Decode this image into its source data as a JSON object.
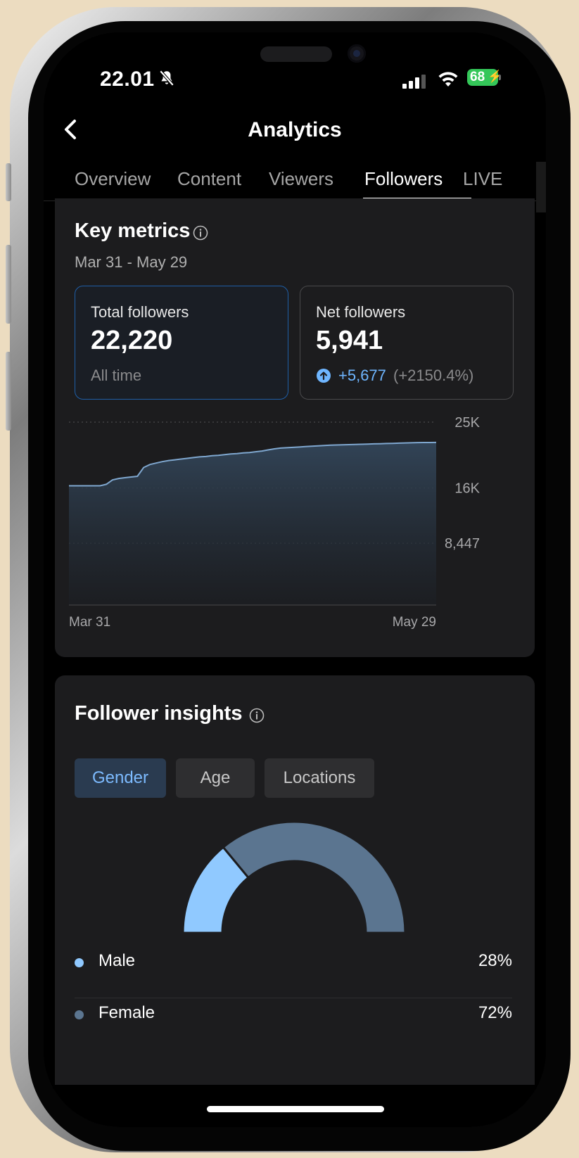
{
  "status_bar": {
    "time": "22.01",
    "battery": "68"
  },
  "nav": {
    "title": "Analytics"
  },
  "tabs": [
    {
      "label": "Overview"
    },
    {
      "label": "Content"
    },
    {
      "label": "Viewers"
    },
    {
      "label": "Followers"
    },
    {
      "label": "LIVE"
    }
  ],
  "active_tab": "Followers",
  "key_metrics": {
    "title": "Key metrics",
    "date_range": "Mar 31 - May 29",
    "total": {
      "label": "Total followers",
      "value": "22,220",
      "sub": "All time"
    },
    "net": {
      "label": "Net followers",
      "value": "5,941",
      "delta": "+5,677",
      "delta_pct": "(+2150.4%)"
    }
  },
  "chart_data": {
    "type": "area",
    "x_start": "Mar 31",
    "x_end": "May 29",
    "y_ticks": [
      "25K",
      "16K",
      "8,447"
    ],
    "y_tick_values": [
      25000,
      16000,
      8447
    ],
    "ylim": [
      0,
      25000
    ],
    "grid": true,
    "series": [
      {
        "values": [
          16300,
          16300,
          16300,
          16300,
          16300,
          16300,
          16500,
          17100,
          17300,
          17400,
          17500,
          17600,
          18800,
          19200,
          19400,
          19600,
          19750,
          19850,
          19950,
          20050,
          20150,
          20250,
          20300,
          20400,
          20450,
          20550,
          20650,
          20700,
          20800,
          20850,
          20950,
          21050,
          21200,
          21350,
          21450,
          21500,
          21550,
          21600,
          21650,
          21700,
          21750,
          21800,
          21850,
          21875,
          21900,
          21925,
          21950,
          21975,
          22000,
          22025,
          22050,
          22075,
          22100,
          22125,
          22150,
          22175,
          22200,
          22210,
          22215,
          22220
        ]
      }
    ]
  },
  "insights": {
    "title": "Follower insights",
    "chips": [
      {
        "label": "Gender"
      },
      {
        "label": "Age"
      },
      {
        "label": "Locations"
      }
    ],
    "gender": [
      {
        "label": "Male",
        "value": "28%",
        "pct": 28,
        "color": "#90c9ff"
      },
      {
        "label": "Female",
        "value": "72%",
        "pct": 72,
        "color": "#5b7590"
      }
    ]
  },
  "colors": {
    "accent": "#6fb6ff",
    "line": "#7fa7cf",
    "card": "#1c1c1e",
    "battery": "#34c759"
  }
}
